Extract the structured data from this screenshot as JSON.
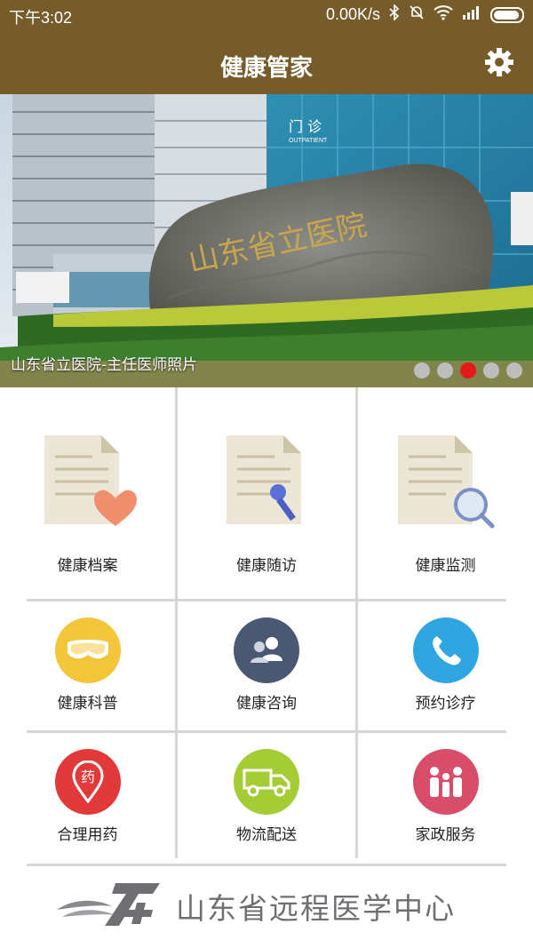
{
  "status_bar": {
    "time": "下午3:02",
    "network_speed": "0.00K/s"
  },
  "header": {
    "title": "健康管家"
  },
  "banner": {
    "caption": "山东省立医院-主任医师照片",
    "sign_text": "门 诊",
    "sign_sub": "OUTPATIENT",
    "stone_text": "山东省立医院",
    "slide_count": 5,
    "active_slide": 3
  },
  "menu": {
    "archive": "健康档案",
    "followup": "健康随访",
    "monitor": "健康监测",
    "science": "健康科普",
    "consult": "健康咨询",
    "appointment": "预约诊疗",
    "medicine": "合理用药",
    "logistics": "物流配送",
    "housekeeping": "家政服务"
  },
  "footer": {
    "org_name": "山东省远程医学中心"
  },
  "colors": {
    "brand": "#765c2b",
    "active_dot": "#e41a1a"
  }
}
